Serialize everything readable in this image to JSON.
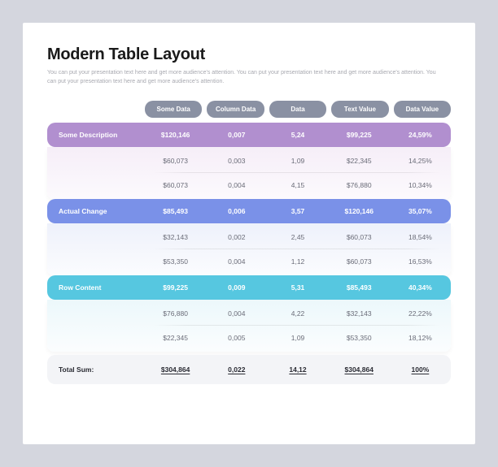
{
  "title": "Modern Table Layout",
  "subtitle": "You can put your presentation text here and get more audience's attention. You can put your presentation text here and get more audience's attention. You can put your presentation text here and get more audience's attention.",
  "columns": [
    "Some Data",
    "Column Data",
    "Data",
    "Text Value",
    "Data Value"
  ],
  "groups": [
    {
      "label": "Some Description",
      "header": [
        "$120,146",
        "0,007",
        "5,24",
        "$99,225",
        "24,59%"
      ],
      "rows": [
        [
          "$60,073",
          "0,003",
          "1,09",
          "$22,345",
          "14,25%"
        ],
        [
          "$60,073",
          "0,004",
          "4,15",
          "$76,880",
          "10,34%"
        ]
      ]
    },
    {
      "label": "Actual Change",
      "header": [
        "$85,493",
        "0,006",
        "3,57",
        "$120,146",
        "35,07%"
      ],
      "rows": [
        [
          "$32,143",
          "0,002",
          "2,45",
          "$60,073",
          "18,54%"
        ],
        [
          "$53,350",
          "0,004",
          "1,12",
          "$60,073",
          "16,53%"
        ]
      ]
    },
    {
      "label": "Row Content",
      "header": [
        "$99,225",
        "0,009",
        "5,31",
        "$85,493",
        "40,34%"
      ],
      "rows": [
        [
          "$76,880",
          "0,004",
          "4,22",
          "$32,143",
          "22,22%"
        ],
        [
          "$22,345",
          "0,005",
          "1,09",
          "$53,350",
          "18,12%"
        ]
      ]
    }
  ],
  "total": {
    "label": "Total Sum:",
    "values": [
      "$304,864",
      "0,022",
      "14,12",
      "$304,864",
      "100%"
    ]
  }
}
